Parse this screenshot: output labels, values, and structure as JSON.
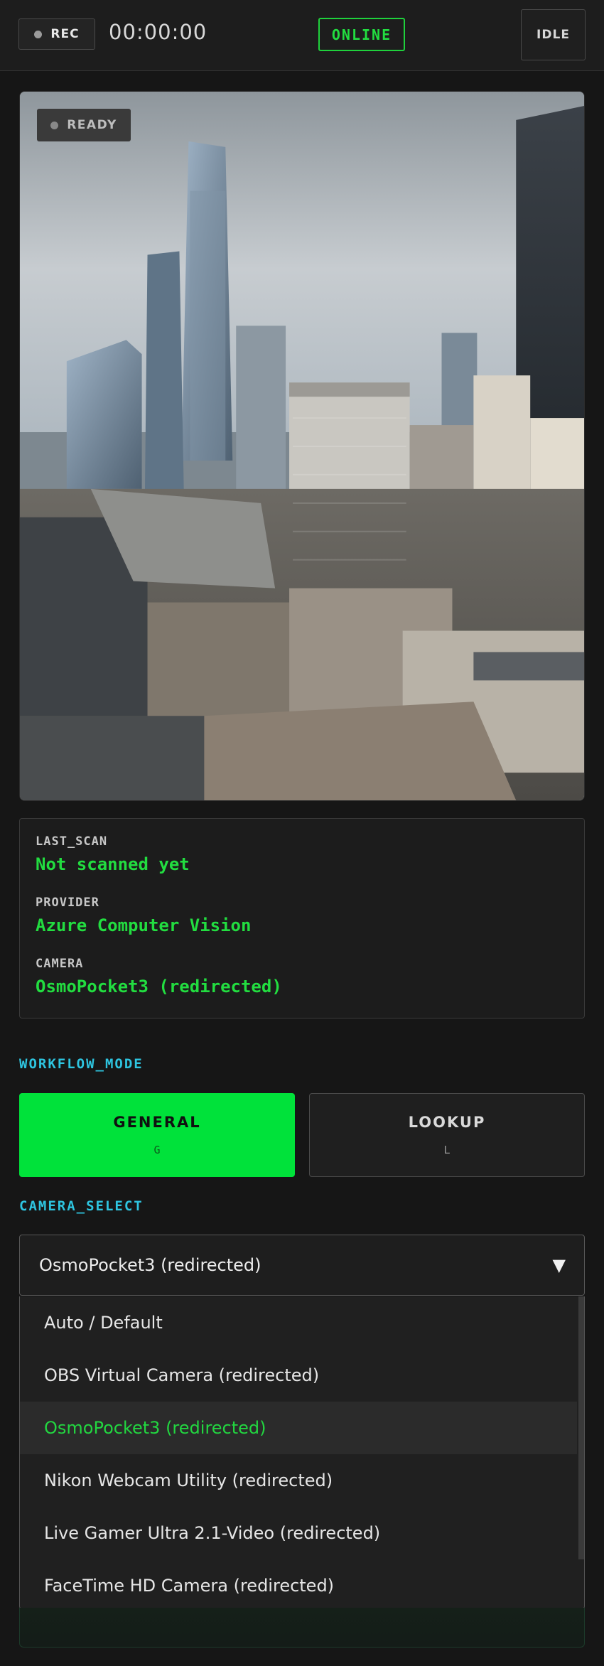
{
  "topbar": {
    "rec_label": "REC",
    "timer": "00:00:00",
    "status": "ONLINE",
    "idle_label": "IDLE",
    "status_color": "#22dd40"
  },
  "preview": {
    "badge": "READY",
    "image": "city skyline camera feed"
  },
  "info": {
    "last_scan_label": "LAST_SCAN",
    "last_scan_value": "Not scanned yet",
    "provider_label": "PROVIDER",
    "provider_value": "Azure Computer Vision",
    "camera_label": "CAMERA",
    "camera_value": "OsmoPocket3 (redirected)"
  },
  "workflow": {
    "label": "WORKFLOW_MODE",
    "modes": [
      {
        "title": "GENERAL",
        "key": "G",
        "active": true
      },
      {
        "title": "LOOKUP",
        "key": "L",
        "active": false
      }
    ],
    "accent": "#00e23a"
  },
  "camera_select": {
    "label": "CAMERA_SELECT",
    "selected": "OsmoPocket3 (redirected)",
    "chevron": "▼",
    "options": [
      "Auto / Default",
      "OBS Virtual Camera (redirected)",
      "OsmoPocket3 (redirected)",
      "Nikon Webcam Utility (redirected)",
      "Live Gamer Ultra 2.1-Video (redirected)",
      "FaceTime HD Camera (redirected)"
    ],
    "selected_index": 2
  },
  "colors": {
    "section_label": "#2ec5e0",
    "background": "#161616"
  }
}
